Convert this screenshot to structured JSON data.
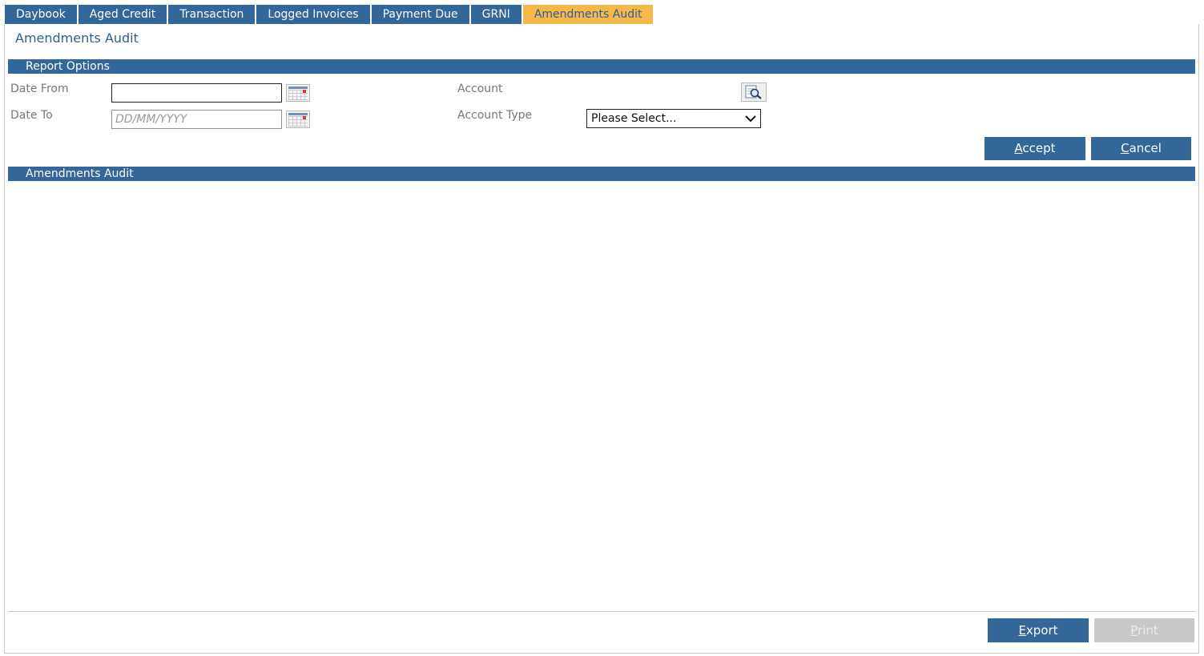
{
  "tabs": [
    {
      "label": "Daybook",
      "active": false
    },
    {
      "label": "Aged Credit",
      "active": false
    },
    {
      "label": "Transaction",
      "active": false
    },
    {
      "label": "Logged Invoices",
      "active": false
    },
    {
      "label": "Payment Due",
      "active": false
    },
    {
      "label": "GRNI",
      "active": false
    },
    {
      "label": "Amendments Audit",
      "active": true
    }
  ],
  "page_title": "Amendments Audit",
  "report_options": {
    "header": "Report Options",
    "date_from": {
      "label": "Date From",
      "value": "",
      "placeholder": ""
    },
    "date_to": {
      "label": "Date To",
      "value": "",
      "placeholder": "DD/MM/YYYY"
    },
    "account": {
      "label": "Account"
    },
    "account_type": {
      "label": "Account Type",
      "selected": "Please Select..."
    },
    "accept": {
      "first": "A",
      "rest": "ccept"
    },
    "cancel": {
      "first": "C",
      "rest": "ancel"
    }
  },
  "results": {
    "header": "Amendments Audit"
  },
  "footer": {
    "export": {
      "first": "E",
      "rest": "xport"
    },
    "print": {
      "first": "P",
      "rest": "rint",
      "disabled": true
    }
  },
  "colors": {
    "primary": "#336699",
    "active_tab": "#f5b84a",
    "active_tab_text": "#2f5f94",
    "disabled": "#c8c8c8"
  },
  "icons": [
    "calendar-icon",
    "lookup-search-icon",
    "chevron-down-icon"
  ]
}
